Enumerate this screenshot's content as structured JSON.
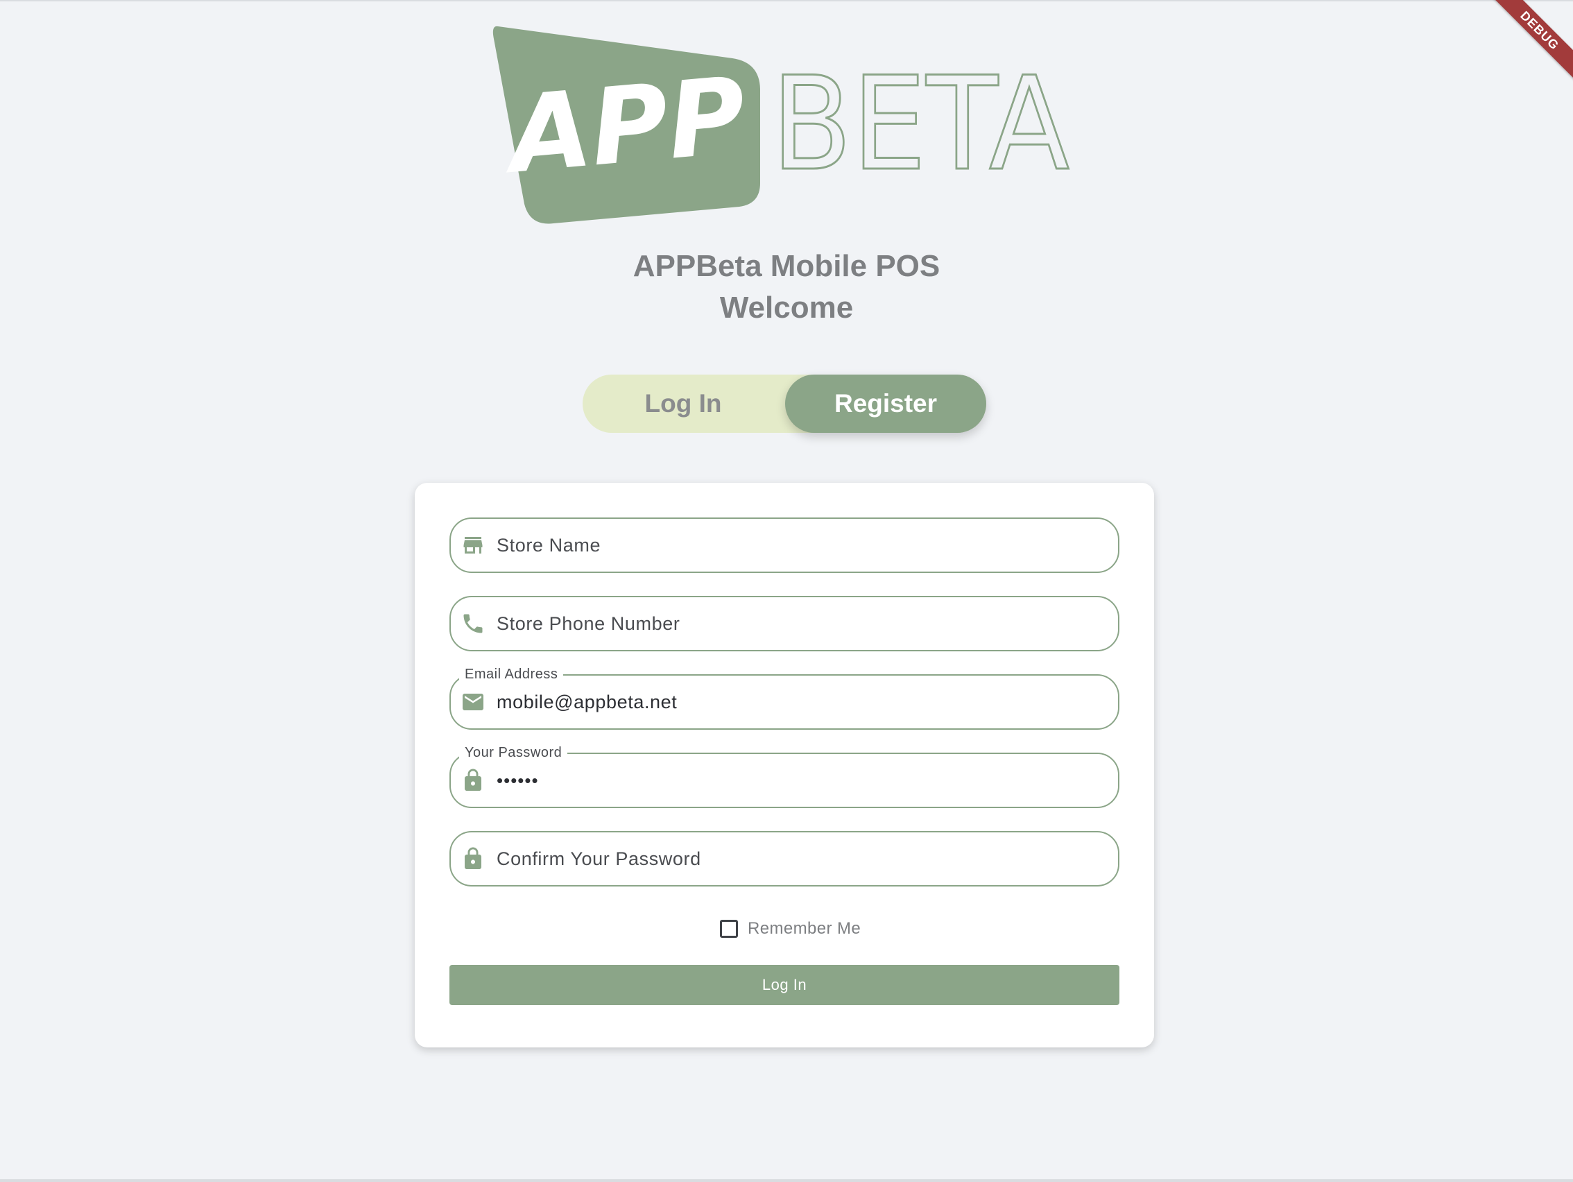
{
  "app": {
    "logo_text_bold": "APP",
    "logo_text_light": "BETA",
    "debug_badge": "DEBUG"
  },
  "heading": {
    "line1": "APPBeta Mobile POS",
    "line2": "Welcome"
  },
  "mode_toggle": {
    "options": [
      "Log In",
      "Register"
    ],
    "selected": "Register"
  },
  "form": {
    "fields": [
      {
        "icon": "store-icon",
        "label": "",
        "placeholder": "Store Name",
        "value": ""
      },
      {
        "icon": "phone-icon",
        "label": "",
        "placeholder": "Store Phone Number",
        "value": ""
      },
      {
        "icon": "email-icon",
        "label": "Email Address",
        "placeholder": "",
        "value": "mobile@appbeta.net"
      },
      {
        "icon": "lock-icon",
        "label": "Your Password",
        "placeholder": "",
        "value": "••••••"
      },
      {
        "icon": "lock-icon",
        "label": "",
        "placeholder": "Confirm Your Password",
        "value": ""
      }
    ],
    "remember_me": {
      "label": "Remember Me",
      "checked": false
    },
    "submit_label": "Log In"
  },
  "colors": {
    "accent": "#8ba588",
    "toggle_bg": "#e4ebc9",
    "page_bg": "#f1f3f6",
    "heading_text": "#7d7f82",
    "debug_ribbon": "#a23b3b"
  }
}
